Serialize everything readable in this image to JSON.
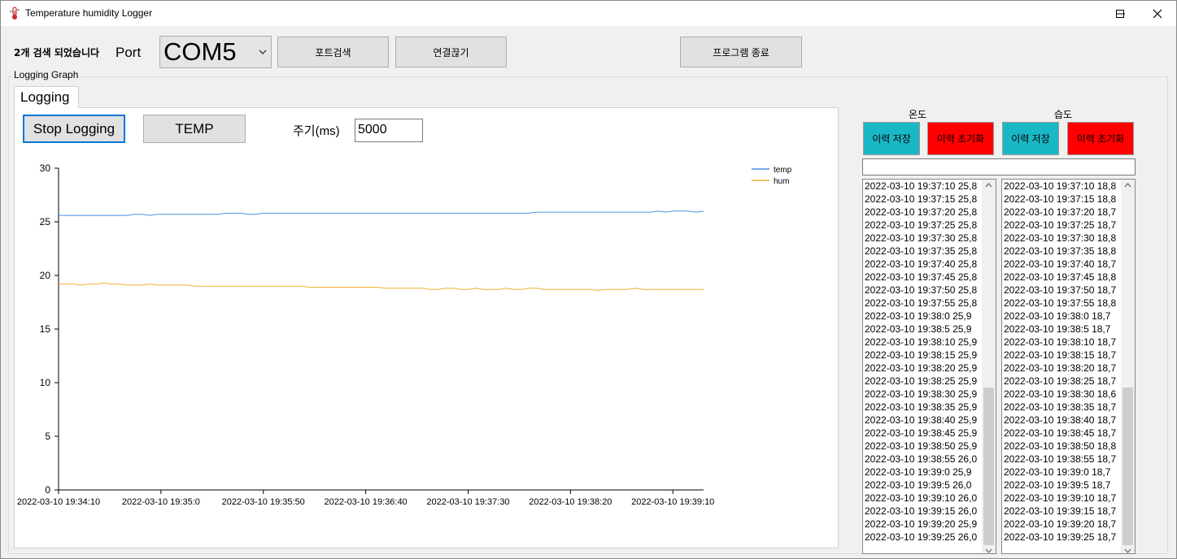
{
  "window": {
    "title": "Temperature humidity Logger"
  },
  "toolbar": {
    "status_text": "2개 검색 되었습니다",
    "port_label": "Port",
    "port_value": "COM5",
    "search_port_label": "포트검색",
    "disconnect_label": "연결끊기",
    "exit_label": "프로그램 종료"
  },
  "group": {
    "title": "Logging Graph",
    "tab_label": "Logging"
  },
  "controls": {
    "stop_logging_label": "Stop Logging",
    "temp_label": "TEMP",
    "period_label": "주기(ms)",
    "period_value": "5000"
  },
  "side": {
    "temp_header": "온도",
    "hum_header": "습도",
    "save_label": "이력 저장",
    "reset_label": "이력 초기화",
    "save_color": "#1ab8c6",
    "reset_color": "#ff0000",
    "search_value": "",
    "temp_log": [
      "2022-03-10 19:37:10 25,8",
      "2022-03-10 19:37:15 25,8",
      "2022-03-10 19:37:20 25,8",
      "2022-03-10 19:37:25 25,8",
      "2022-03-10 19:37:30 25,8",
      "2022-03-10 19:37:35 25,8",
      "2022-03-10 19:37:40 25,8",
      "2022-03-10 19:37:45 25,8",
      "2022-03-10 19:37:50 25,8",
      "2022-03-10 19:37:55 25,8",
      "2022-03-10 19:38:0 25,9",
      "2022-03-10 19:38:5 25,9",
      "2022-03-10 19:38:10 25,9",
      "2022-03-10 19:38:15 25,9",
      "2022-03-10 19:38:20 25,9",
      "2022-03-10 19:38:25 25,9",
      "2022-03-10 19:38:30 25,9",
      "2022-03-10 19:38:35 25,9",
      "2022-03-10 19:38:40 25,9",
      "2022-03-10 19:38:45 25,9",
      "2022-03-10 19:38:50 25,9",
      "2022-03-10 19:38:55 26,0",
      "2022-03-10 19:39:0 25,9",
      "2022-03-10 19:39:5 26,0",
      "2022-03-10 19:39:10 26,0",
      "2022-03-10 19:39:15 26,0",
      "2022-03-10 19:39:20 25,9",
      "2022-03-10 19:39:25 26,0"
    ],
    "hum_log": [
      "2022-03-10 19:37:10 18,8",
      "2022-03-10 19:37:15 18,8",
      "2022-03-10 19:37:20 18,7",
      "2022-03-10 19:37:25 18,7",
      "2022-03-10 19:37:30 18,8",
      "2022-03-10 19:37:35 18,8",
      "2022-03-10 19:37:40 18,7",
      "2022-03-10 19:37:45 18,8",
      "2022-03-10 19:37:50 18,7",
      "2022-03-10 19:37:55 18,8",
      "2022-03-10 19:38:0 18,7",
      "2022-03-10 19:38:5 18,7",
      "2022-03-10 19:38:10 18,7",
      "2022-03-10 19:38:15 18,7",
      "2022-03-10 19:38:20 18,7",
      "2022-03-10 19:38:25 18,7",
      "2022-03-10 19:38:30 18,6",
      "2022-03-10 19:38:35 18,7",
      "2022-03-10 19:38:40 18,7",
      "2022-03-10 19:38:45 18,7",
      "2022-03-10 19:38:50 18,8",
      "2022-03-10 19:38:55 18,7",
      "2022-03-10 19:39:0 18,7",
      "2022-03-10 19:39:5 18,7",
      "2022-03-10 19:39:10 18,7",
      "2022-03-10 19:39:15 18,7",
      "2022-03-10 19:39:20 18,7",
      "2022-03-10 19:39:25 18,7"
    ]
  },
  "chart_data": {
    "type": "line",
    "title": "",
    "xlabel": "",
    "ylabel": "",
    "ylim": [
      0,
      30
    ],
    "yticks": [
      0,
      5,
      10,
      15,
      20,
      25,
      30
    ],
    "x_tick_labels": [
      "2022-03-10 19:34:10",
      "2022-03-10 19:35:0",
      "2022-03-10 19:35:50",
      "2022-03-10 19:36:40",
      "2022-03-10 19:37:30",
      "2022-03-10 19:38:20",
      "2022-03-10 19:39:10"
    ],
    "x_start_seconds": 0,
    "x_end_seconds": 315,
    "x_tick_interval_seconds": 50,
    "grid": false,
    "legend_position": "top-right",
    "series": [
      {
        "name": "temp",
        "color": "#4a90e2",
        "values": [
          25.6,
          25.6,
          25.6,
          25.6,
          25.6,
          25.6,
          25.6,
          25.6,
          25.6,
          25.6,
          25.7,
          25.7,
          25.6,
          25.7,
          25.7,
          25.7,
          25.7,
          25.7,
          25.7,
          25.7,
          25.7,
          25.7,
          25.8,
          25.8,
          25.8,
          25.7,
          25.7,
          25.8,
          25.8,
          25.8,
          25.8,
          25.8,
          25.8,
          25.8,
          25.8,
          25.8,
          25.8,
          25.8,
          25.8,
          25.8,
          25.8,
          25.8,
          25.8,
          25.8,
          25.8,
          25.8,
          25.8,
          25.8,
          25.8,
          25.8,
          25.8,
          25.8,
          25.8,
          25.8,
          25.8,
          25.8,
          25.8,
          25.8,
          25.8,
          25.8,
          25.8,
          25.8,
          25.8,
          25.9,
          25.9,
          25.9,
          25.9,
          25.9,
          25.9,
          25.9,
          25.9,
          25.9,
          25.9,
          25.9,
          25.9,
          25.9,
          25.9,
          25.9,
          25.9,
          26.0,
          25.9,
          26.0,
          26.0,
          26.0,
          25.9,
          26.0
        ]
      },
      {
        "name": "hum",
        "color": "#f0b030",
        "values": [
          19.2,
          19.2,
          19.2,
          19.1,
          19.2,
          19.2,
          19.3,
          19.2,
          19.2,
          19.1,
          19.1,
          19.1,
          19.2,
          19.1,
          19.1,
          19.1,
          19.1,
          19.1,
          19.0,
          19.0,
          19.0,
          19.0,
          19.0,
          19.0,
          19.0,
          19.0,
          19.0,
          19.0,
          19.0,
          19.0,
          19.0,
          19.0,
          19.0,
          18.9,
          18.9,
          18.9,
          18.9,
          18.9,
          18.9,
          18.9,
          18.9,
          18.9,
          18.9,
          18.8,
          18.8,
          18.8,
          18.8,
          18.8,
          18.8,
          18.7,
          18.7,
          18.8,
          18.8,
          18.7,
          18.7,
          18.8,
          18.7,
          18.7,
          18.7,
          18.8,
          18.7,
          18.7,
          18.8,
          18.8,
          18.7,
          18.7,
          18.7,
          18.7,
          18.7,
          18.7,
          18.7,
          18.6,
          18.7,
          18.7,
          18.7,
          18.7,
          18.8,
          18.7,
          18.7,
          18.7,
          18.7,
          18.7,
          18.7,
          18.7,
          18.7,
          18.7
        ]
      }
    ]
  }
}
